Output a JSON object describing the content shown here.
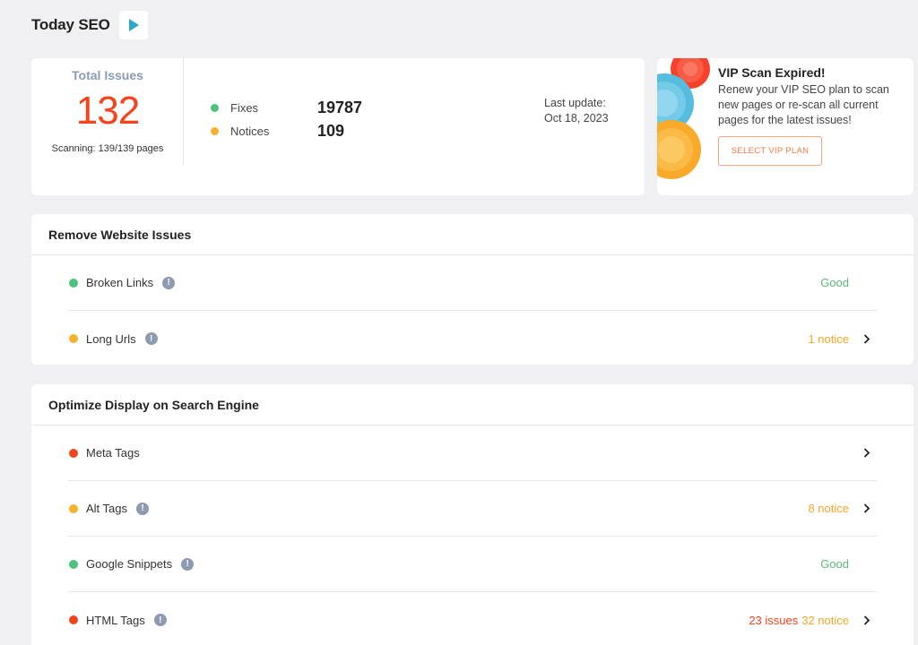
{
  "header": {
    "title": "Today SEO",
    "play_icon": "play-icon"
  },
  "stats": {
    "total_label": "Total Issues",
    "total_value": "132",
    "scanning": "Scanning: 139/139 pages",
    "fixes_label": "Fixes",
    "fixes_value": "19787",
    "notices_label": "Notices",
    "notices_value": "109",
    "last_update_label": "Last update:",
    "last_update_date": "Oct 18, 2023"
  },
  "promo": {
    "title": "VIP Scan Expired!",
    "text": "Renew your VIP SEO plan to scan new pages or re-scan all current pages for the latest issues!",
    "button": "SELECT VIP PLAN"
  },
  "sections": [
    {
      "title": "Remove Website Issues",
      "rows": [
        {
          "label": "Broken Links",
          "dot": "green",
          "info": true,
          "status": "Good",
          "status_color": "green",
          "chevron": false
        },
        {
          "label": "Long Urls",
          "dot": "orange",
          "info": true,
          "status": "1 notice",
          "status_color": "orange",
          "chevron": true
        }
      ]
    },
    {
      "title": "Optimize Display on Search Engine",
      "rows": [
        {
          "label": "Meta Tags",
          "dot": "red",
          "info": false,
          "status": "",
          "status_color": "",
          "chevron": true
        },
        {
          "label": "Alt Tags",
          "dot": "orange",
          "info": true,
          "status": "8 notice",
          "status_color": "orange",
          "chevron": true
        },
        {
          "label": "Google Snippets",
          "dot": "green",
          "info": true,
          "status": "Good",
          "status_color": "green",
          "chevron": false
        },
        {
          "label": "HTML Tags",
          "dot": "red",
          "info": true,
          "status_issues": "23 issues",
          "status": "32 notice",
          "status_color": "orange",
          "chevron": true
        }
      ]
    }
  ],
  "colors": {
    "green": "#4cc37b",
    "orange": "#f9b02b",
    "red": "#f0441c",
    "accent_cyan": "#29a8c8"
  }
}
